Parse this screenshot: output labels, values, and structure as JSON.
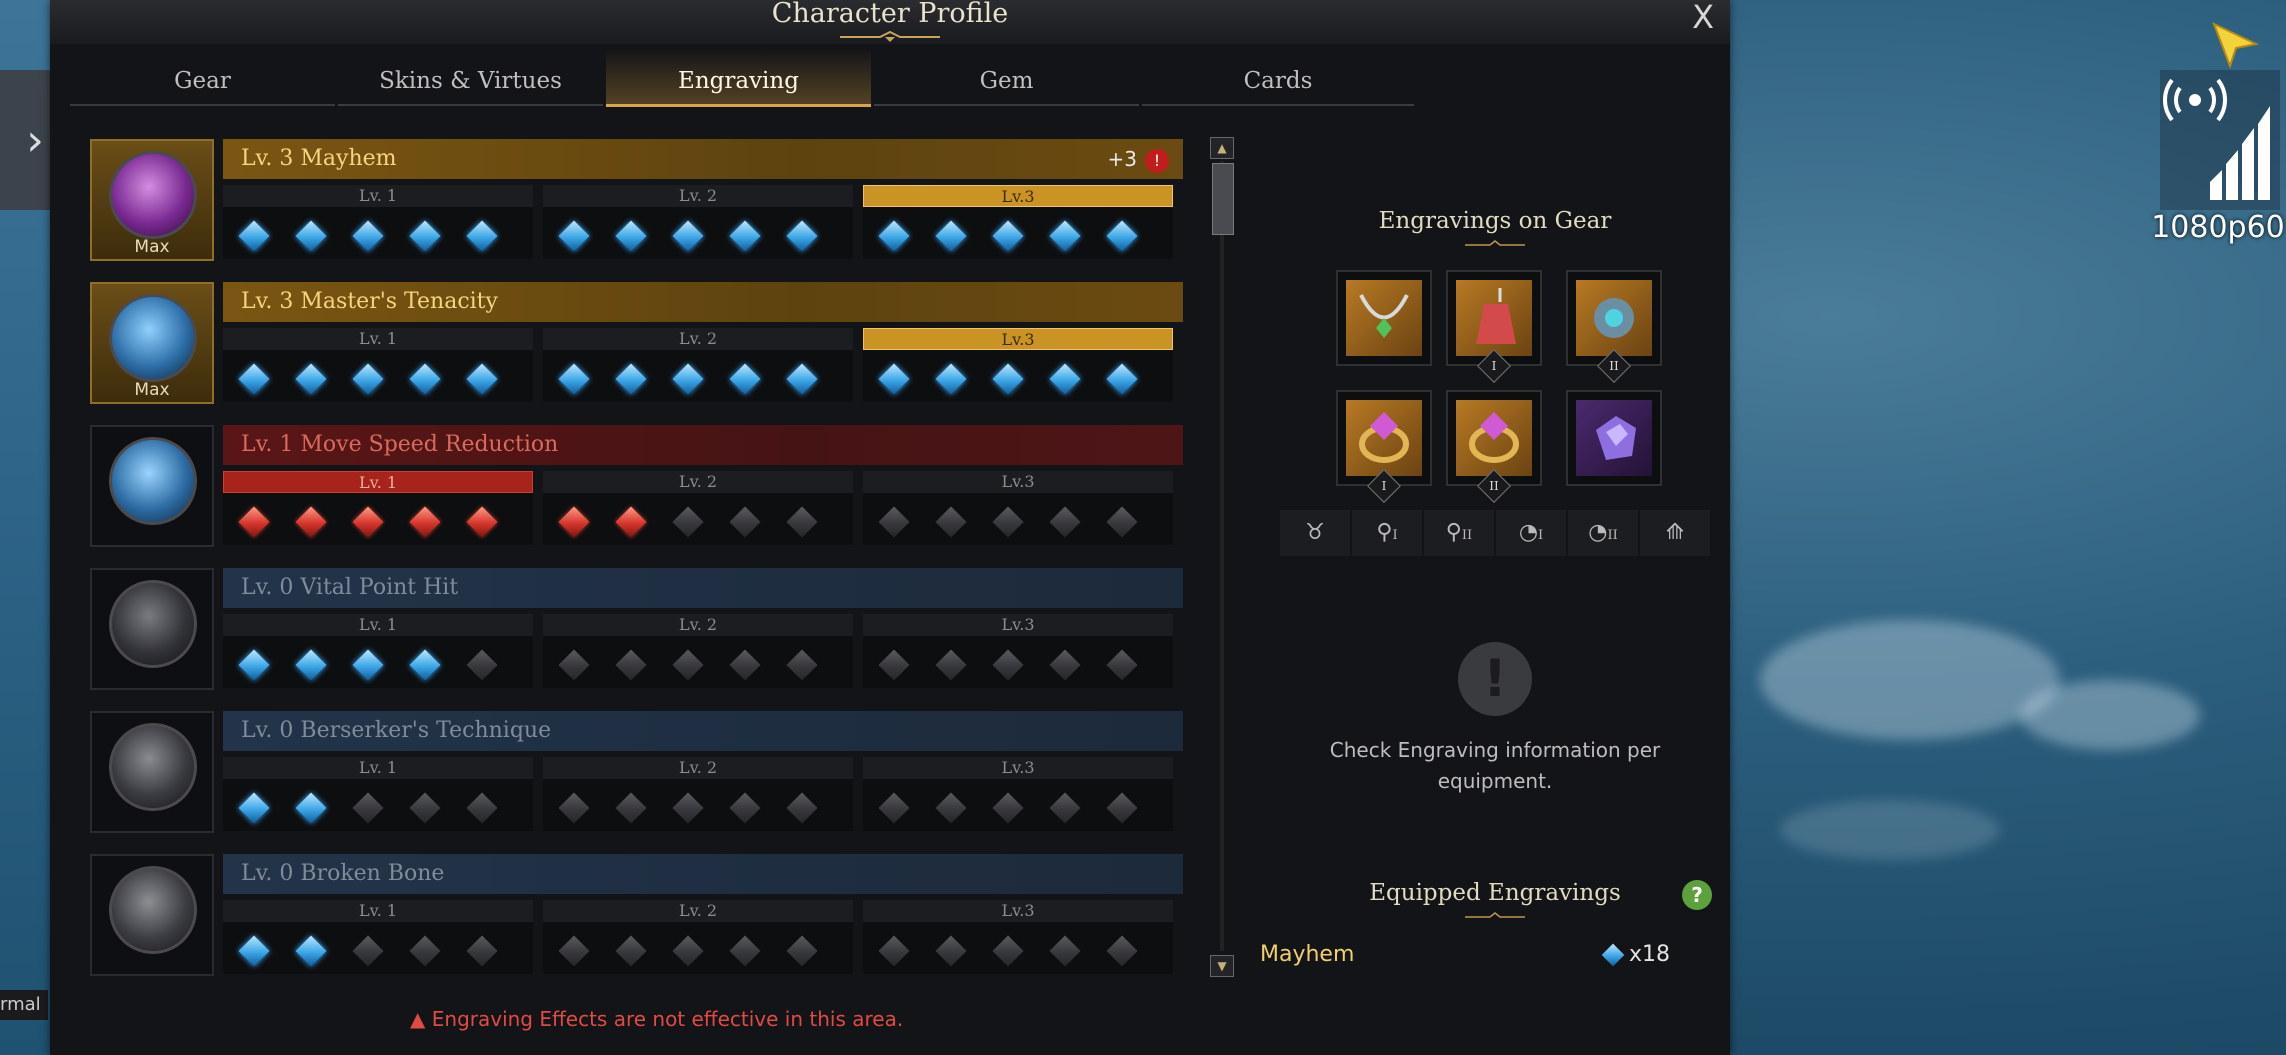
{
  "window": {
    "title": "Character Profile",
    "close_label": "X"
  },
  "tabs": [
    {
      "label": "Gear",
      "active": false
    },
    {
      "label": "Skins & Virtues",
      "active": false
    },
    {
      "label": "Engraving",
      "active": true
    },
    {
      "label": "Gem",
      "active": false
    },
    {
      "label": "Cards",
      "active": false
    }
  ],
  "level_labels": [
    "Lv. 1",
    "Lv. 2",
    "Lv.3"
  ],
  "engravings": [
    {
      "name": "Lv. 3 Mayhem",
      "style": "gold",
      "max_label": "Max",
      "bonus": "+3",
      "bonus_icon": "!",
      "filled": 15,
      "node_color": "blue",
      "active_level": 3
    },
    {
      "name": "Lv. 3 Master's Tenacity",
      "style": "gold",
      "max_label": "Max",
      "bonus": "",
      "filled": 15,
      "node_color": "blue",
      "active_level": 3
    },
    {
      "name": "Lv. 1 Move Speed Reduction",
      "style": "red",
      "max_label": "",
      "bonus": "",
      "filled": 7,
      "node_color": "red",
      "active_level": 1
    },
    {
      "name": "Lv. 0 Vital Point Hit",
      "style": "gray",
      "max_label": "",
      "bonus": "",
      "filled": 4,
      "node_color": "blue",
      "active_level": 0
    },
    {
      "name": "Lv. 0 Berserker's Technique",
      "style": "gray",
      "max_label": "",
      "bonus": "",
      "filled": 2,
      "node_color": "blue",
      "active_level": 0
    },
    {
      "name": "Lv. 0 Broken Bone",
      "style": "gray",
      "max_label": "",
      "bonus": "",
      "filled": 2,
      "node_color": "blue",
      "active_level": 0
    }
  ],
  "warning": "Engraving Effects are not effective in this area.",
  "side_panel": {
    "gear_title": "Engravings on Gear",
    "slots": [
      {
        "icon": "necklace-icon",
        "numeral": ""
      },
      {
        "icon": "earring-icon",
        "numeral": "I"
      },
      {
        "icon": "earring-icon",
        "numeral": "II"
      },
      {
        "icon": "ring-icon",
        "numeral": "I"
      },
      {
        "icon": "ring-icon",
        "numeral": "II"
      },
      {
        "icon": "ability-stone-icon",
        "numeral": ""
      }
    ],
    "filters": [
      {
        "icon": "necklace-filter-icon",
        "label": ""
      },
      {
        "icon": "earring-filter-icon",
        "label": "I"
      },
      {
        "icon": "earring-filter-icon",
        "label": "II"
      },
      {
        "icon": "ring-filter-icon",
        "label": "I"
      },
      {
        "icon": "ring-filter-icon",
        "label": "II"
      },
      {
        "icon": "stone-filter-icon",
        "label": ""
      }
    ],
    "info_icon": "!",
    "info_text_line1": "Check Engraving information per",
    "info_text_line2": "equipment.",
    "equipped_title": "Equipped Engravings",
    "help_label": "?",
    "equipped": [
      {
        "name": "Mayhem",
        "count": "x18"
      }
    ]
  },
  "overlay": {
    "quality_label": "1080p60",
    "side_tag": "rmal"
  },
  "colors": {
    "gold": "#c99423",
    "red": "#a8231c",
    "blue_node": "#3ba6e6",
    "warning": "#e04a45"
  }
}
